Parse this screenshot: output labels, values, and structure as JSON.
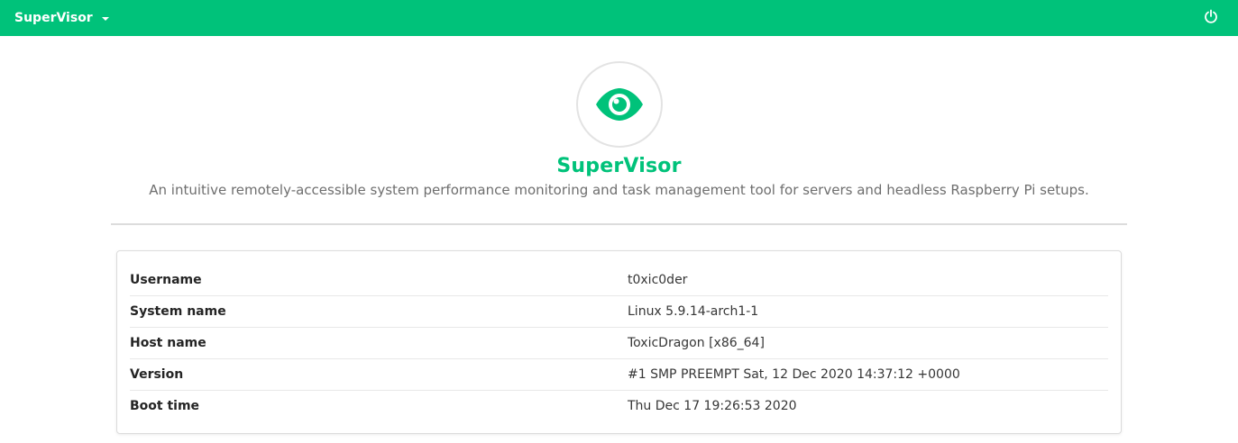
{
  "navbar": {
    "brand_label": "SuperVisor",
    "dropdown_icon": "caret-down-icon",
    "power_icon": "power-icon",
    "color": "#00c27a"
  },
  "hero": {
    "logo_icon": "eye-icon",
    "title": "SuperVisor",
    "description": "An intuitive remotely-accessible system performance monitoring and task management tool for servers and headless Raspberry Pi setups."
  },
  "system_info": {
    "rows": [
      {
        "label": "Username",
        "value": "t0xic0der"
      },
      {
        "label": "System name",
        "value": "Linux 5.9.14-arch1-1"
      },
      {
        "label": "Host name",
        "value": "ToxicDragon [x86_64]"
      },
      {
        "label": "Version",
        "value": "#1 SMP PREEMPT Sat, 12 Dec 2020 14:37:12 +0000"
      },
      {
        "label": "Boot time",
        "value": "Thu Dec 17 19:26:53 2020"
      }
    ]
  }
}
